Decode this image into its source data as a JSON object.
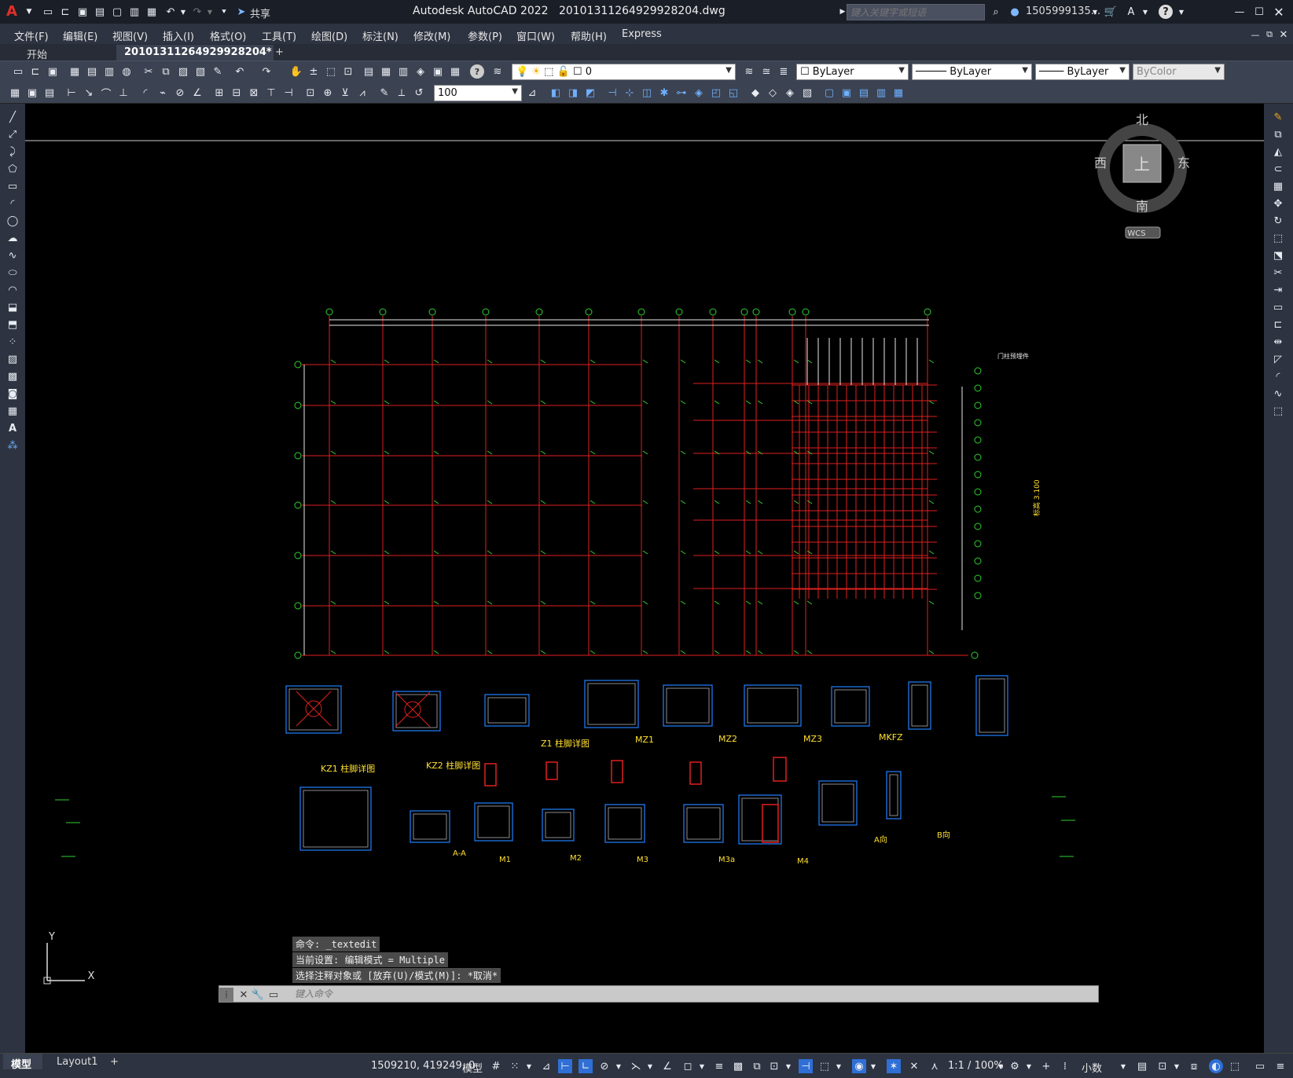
{
  "titlebar": {
    "app_logo": "A",
    "share_label": "共享",
    "app_name": "Autodesk AutoCAD 2022",
    "file_name": "20101311264929928204.dwg",
    "search_placeholder": "键入关键字或短语",
    "user_name": "1505999135..."
  },
  "menu": [
    "文件(F)",
    "编辑(E)",
    "视图(V)",
    "插入(I)",
    "格式(O)",
    "工具(T)",
    "绘图(D)",
    "标注(N)",
    "修改(M)",
    "参数(P)",
    "窗口(W)",
    "帮助(H)",
    "Express"
  ],
  "tabs": {
    "start": "开始",
    "drawing": "20101311264929928204*",
    "add": "+"
  },
  "layer": {
    "current": "0"
  },
  "properties": {
    "color": "ByLayer",
    "linetype": "ByLayer",
    "lineweight": "ByLayer",
    "plotstyle": "ByColor"
  },
  "scale_combo": "100",
  "viewcube": {
    "north": "北",
    "south": "南",
    "east": "东",
    "west": "西",
    "face": "上",
    "wcs": "WCS"
  },
  "ucs": {
    "x": "X",
    "y": "Y"
  },
  "drawing_labels": {
    "kz1": "KZ1 柱脚详图",
    "kz2": "KZ2 柱脚详图",
    "z1": "Z1 柱脚详图",
    "mz1": "MZ1",
    "mz2": "MZ2",
    "mz3": "MZ3",
    "mkfz": "MKFZ",
    "m1": "M1",
    "m2": "M2",
    "m3": "M3",
    "m3a": "M3a",
    "m4": "M4",
    "aa": "A-A",
    "a_dir": "A向",
    "b_dir": "B向",
    "door_frame": "门柱预埋件",
    "elevation_note": "标高 3.100"
  },
  "command": {
    "history": [
      "命令: _textedit",
      "当前设置: 编辑模式 = Multiple",
      "选择注释对象或 [放弃(U)/模式(M)]: *取消*"
    ],
    "placeholder": "键入命令"
  },
  "layout_tabs": [
    "模型",
    "Layout1",
    "+"
  ],
  "status": {
    "coordinates": "1509210, 419249, 0",
    "space": "模型",
    "annotation_scale": "1:1 / 100%",
    "units": "小数"
  },
  "colors": {
    "grid": "#e02020",
    "annotation": "#2fd02f",
    "dimension": "#e8e8e8",
    "detail": "#2080ff",
    "title": "#ffe030"
  }
}
